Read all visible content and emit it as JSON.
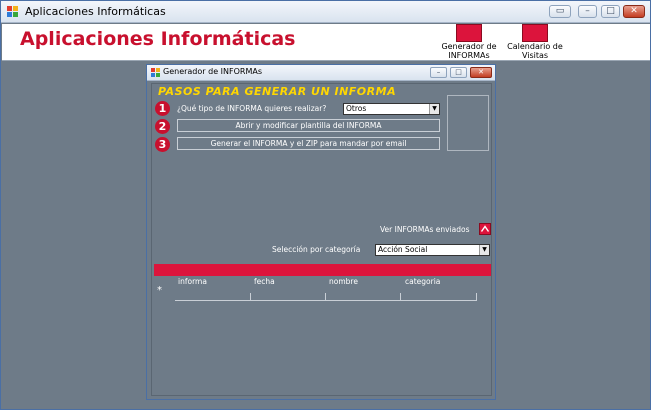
{
  "window": {
    "title": "Aplicaciones Informáticas",
    "minimize_glyph": "▭",
    "restore_glyph": "□",
    "close_glyph": "✕"
  },
  "header": {
    "title": "Aplicaciones Informáticas",
    "buttons": [
      {
        "label_line1": "Generador de",
        "label_line2": "INFORMAs"
      },
      {
        "label_line1": "Calendario de",
        "label_line2": "Visitas"
      }
    ],
    "accent_color": "#dc143c",
    "title_color": "#c8102e"
  },
  "child_window": {
    "title": "Generador de INFORMAs",
    "minimize_glyph": "–",
    "restore_glyph": "□",
    "close_glyph": "✕"
  },
  "panel": {
    "heading": "PASOS PARA GENERAR UN INFORMA",
    "step1": {
      "number": "1",
      "label": "¿Qué tipo de INFORMA quieres realizar?",
      "selected": "Otros"
    },
    "step2": {
      "number": "2",
      "button": "Abrir y modificar plantilla del INFORMA"
    },
    "step3": {
      "number": "3",
      "button": "Generar el INFORMA y el ZIP para mandar por email"
    },
    "sent_label": "Ver INFORMAs enviados",
    "category_label": "Selección por categoría",
    "category_selected": "Acción Social",
    "table_columns": [
      "informa",
      "fecha",
      "nombre",
      "categoria"
    ],
    "new_row_marker": "*"
  }
}
